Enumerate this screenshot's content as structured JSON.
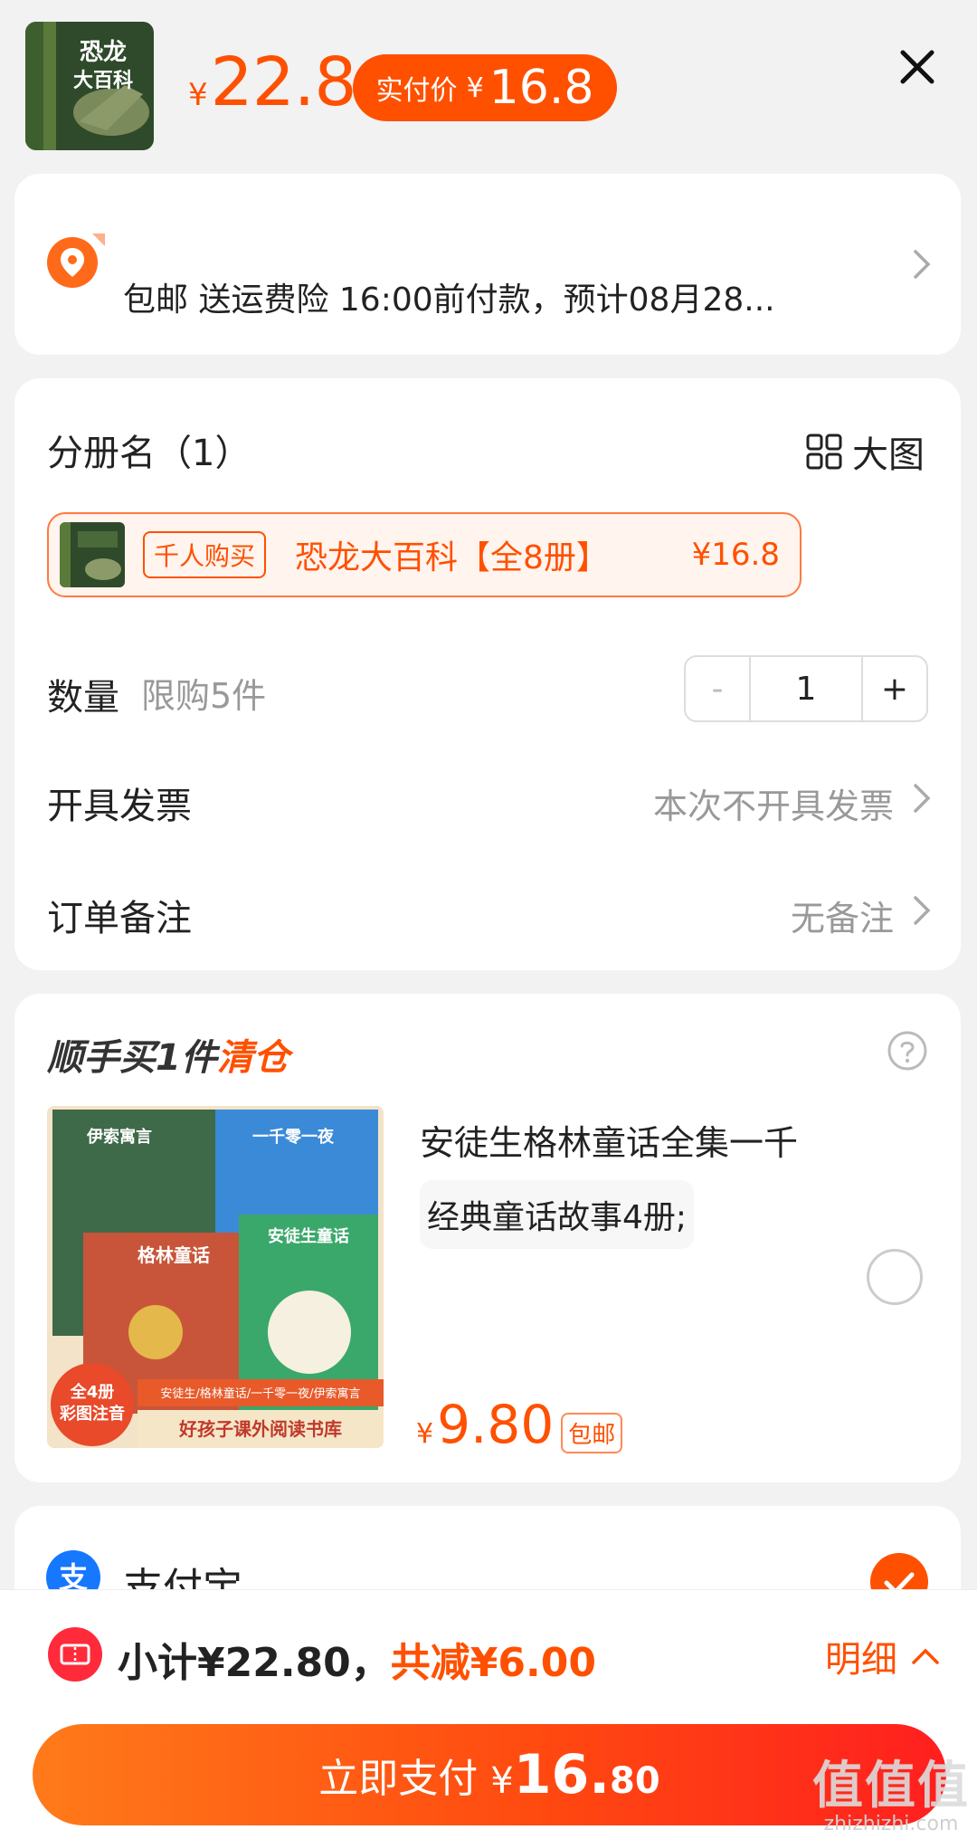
{
  "header": {
    "original_price_currency": "¥",
    "original_price": "22.8",
    "pay_label": "实付价",
    "pay_currency": "¥",
    "pay_value": "16.8",
    "thumb_text_line1": "恐龙",
    "thumb_text_line2": "大百科"
  },
  "address": {
    "shipping_line": "包邮 送运费险 16:00前付款，预计08月28..."
  },
  "sku": {
    "group_label": "分册名（1）",
    "big_image_label": "大图",
    "option": {
      "tag": "千人购买",
      "name": "恐龙大百科【全8册】",
      "price": "¥16.8"
    },
    "quantity_label": "数量",
    "quantity_hint": "限购5件",
    "quantity_minus": "-",
    "quantity_value": "1",
    "quantity_plus": "+",
    "invoice_label": "开具发票",
    "invoice_value": "本次不开具发票",
    "remark_label": "订单备注",
    "remark_value": "无备注"
  },
  "upsell": {
    "title_prefix": "顺手买1件",
    "title_highlight": "清仓",
    "desc_line1": "安徒生格林童话全集一千",
    "desc_line2": "经典童话故事4册;",
    "price_currency": "¥",
    "price_value": "9.80",
    "shipping_tag": "包邮",
    "cover": {
      "book1": "伊索寓言",
      "book2": "一千零一夜",
      "book3": "格林童话",
      "book4": "安徒生童话",
      "badge_line1": "全4册",
      "badge_line2": "彩图注音",
      "series_line": "安徒生/格林童话/一千零一夜/伊索寓言",
      "series_name": "好孩子课外阅读书库"
    }
  },
  "payment": {
    "method_label": "支付宝"
  },
  "bottom": {
    "subtotal_label": "小计¥22.80，",
    "saving_label": "共减¥6.00",
    "detail_label": "明细",
    "pay_button_label": "立即支付",
    "pay_button_currency": "¥",
    "pay_button_int": "16.",
    "pay_button_dec": "80"
  },
  "watermark": {
    "big": "值值值",
    "small": "zhizhizhi.com"
  },
  "colors": {
    "accent": "#ff5000",
    "alipay_blue": "#1677ff",
    "coupon_red": "#ff2a3a"
  },
  "icons": [
    "close-icon",
    "location-pin-icon",
    "chevron-right-icon",
    "grid-icon",
    "help-icon",
    "radio-unchecked-icon",
    "alipay-icon",
    "check-circle-icon",
    "coupon-icon",
    "chevron-up-icon"
  ]
}
